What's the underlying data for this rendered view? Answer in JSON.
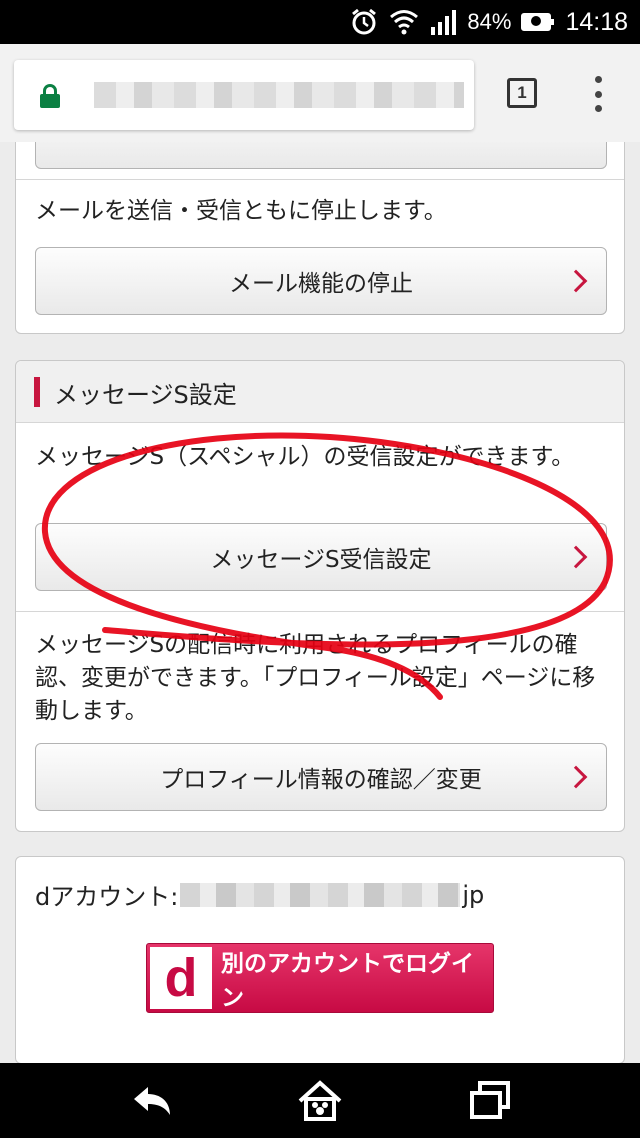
{
  "status_bar": {
    "battery_percent": "84%",
    "time": "14:18",
    "icons": [
      "alarm-icon",
      "wifi-icon",
      "signal-icon",
      "battery-icon"
    ]
  },
  "browser": {
    "tab_count": "1",
    "icons": [
      "lock-icon",
      "tabs-icon",
      "overflow-menu-icon"
    ]
  },
  "mail_section": {
    "description": "メールを送信・受信ともに停止します。",
    "stop_button_label": "メール機能の停止"
  },
  "message_s_section": {
    "title": "メッセージS設定",
    "description": "メッセージS（スペシャル）の受信設定ができます。",
    "receive_settings_button_label": "メッセージS受信設定",
    "profile_description": "メッセージSの配信時に利用されるプロフィールの確認、変更ができます。「プロフィール設定」ページに移動します。",
    "profile_button_label": "プロフィール情報の確認／変更"
  },
  "account_section": {
    "account_prefix": "dアカウント:",
    "account_suffix": "jp",
    "login_logo": "d",
    "login_button_label": "別のアカウントでログイン"
  },
  "colors": {
    "accent": "#c7163f",
    "annotation": "#e60012",
    "lock": "#0b8043"
  },
  "nav_bar": {
    "icons": [
      "back-icon",
      "home-icon",
      "recent-apps-icon"
    ]
  }
}
